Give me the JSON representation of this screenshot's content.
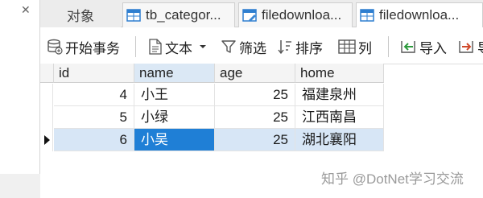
{
  "window": {
    "close_glyph": "✕"
  },
  "tabs": [
    {
      "label": "对象"
    },
    {
      "label": "tb_categor...",
      "icon": "table-icon"
    },
    {
      "label": "filedownloa...",
      "icon": "query-icon"
    },
    {
      "label": "filedownloa...",
      "icon": "table-icon"
    }
  ],
  "toolbar": {
    "begin_transaction": "开始事务",
    "text": "文本",
    "filter": "筛选",
    "sort": "排序",
    "columns": "列",
    "import": "导入",
    "export": "导"
  },
  "grid": {
    "columns": [
      "id",
      "name",
      "age",
      "home"
    ],
    "rows": [
      {
        "id": "4",
        "name": "小王",
        "age": "25",
        "home": "福建泉州"
      },
      {
        "id": "5",
        "name": "小绿",
        "age": "25",
        "home": "江西南昌"
      },
      {
        "id": "6",
        "name": "小吴",
        "age": "25",
        "home": "湖北襄阳"
      }
    ],
    "selected_row": 2
  },
  "colors": {
    "selection": "#d7e6f6",
    "focus_cell": "#1f7fd6"
  },
  "watermark": "知乎 @DotNet学习交流"
}
